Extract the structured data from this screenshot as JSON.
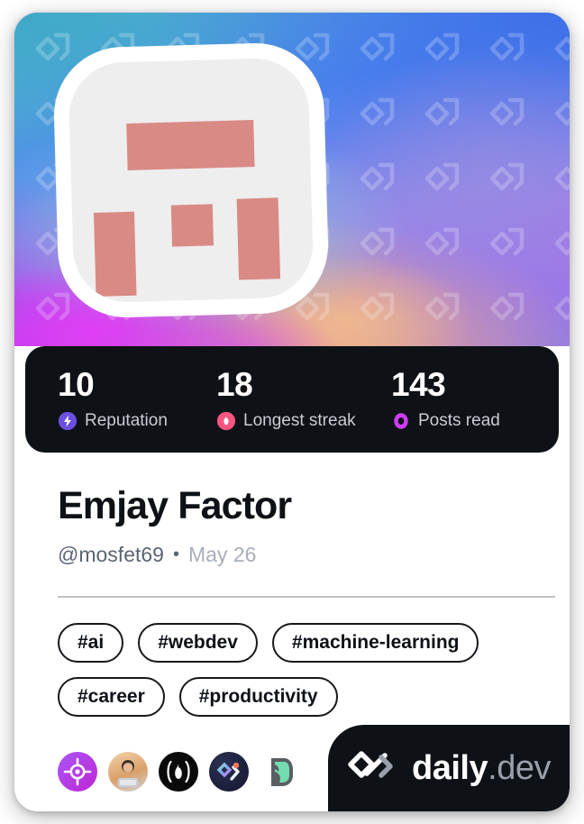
{
  "card": {
    "type": "daily.dev developer profile card",
    "background_color": "#ffffff"
  },
  "cover": {
    "watermark_icon": "daily-dev-chevron-pattern",
    "gradient_colors": [
      "#56b8cf",
      "#4f87ef",
      "#9a86e8",
      "#c76ce6",
      "#e23cf5",
      "#f5be8c"
    ]
  },
  "avatar": {
    "alt": "user avatar",
    "frame_color": "#ffffff",
    "face_color": "#eeeeef",
    "accent_color": "#d98a85"
  },
  "stats": [
    {
      "value": "10",
      "label": "Reputation",
      "icon": "reputation-bolt-icon",
      "color": "#6b4fe0"
    },
    {
      "value": "18",
      "label": "Longest streak",
      "icon": "streak-flame-icon",
      "color": "#f7557f"
    },
    {
      "value": "143",
      "label": "Posts read",
      "icon": "posts-read-eye-icon",
      "color": "#ce3df3"
    }
  ],
  "profile": {
    "display_name": "Emjay Factor",
    "username": "@mosfet69",
    "separator": "•",
    "joined_date": "May 26"
  },
  "tags": [
    {
      "label": "#ai"
    },
    {
      "label": "#webdev"
    },
    {
      "label": "#machine-learning"
    },
    {
      "label": "#career"
    },
    {
      "label": "#productivity"
    }
  ],
  "sources": [
    {
      "icon": "target-crosshair-source-icon"
    },
    {
      "icon": "avatar-person-source-icon"
    },
    {
      "icon": "flame-source-icon"
    },
    {
      "icon": "colorful-marks-source-icon"
    },
    {
      "icon": "green-leaf-d-source-icon"
    }
  ],
  "branding": {
    "logo_icon": "daily-dev-logo-icon",
    "name": "daily",
    "tld": ".dev"
  }
}
